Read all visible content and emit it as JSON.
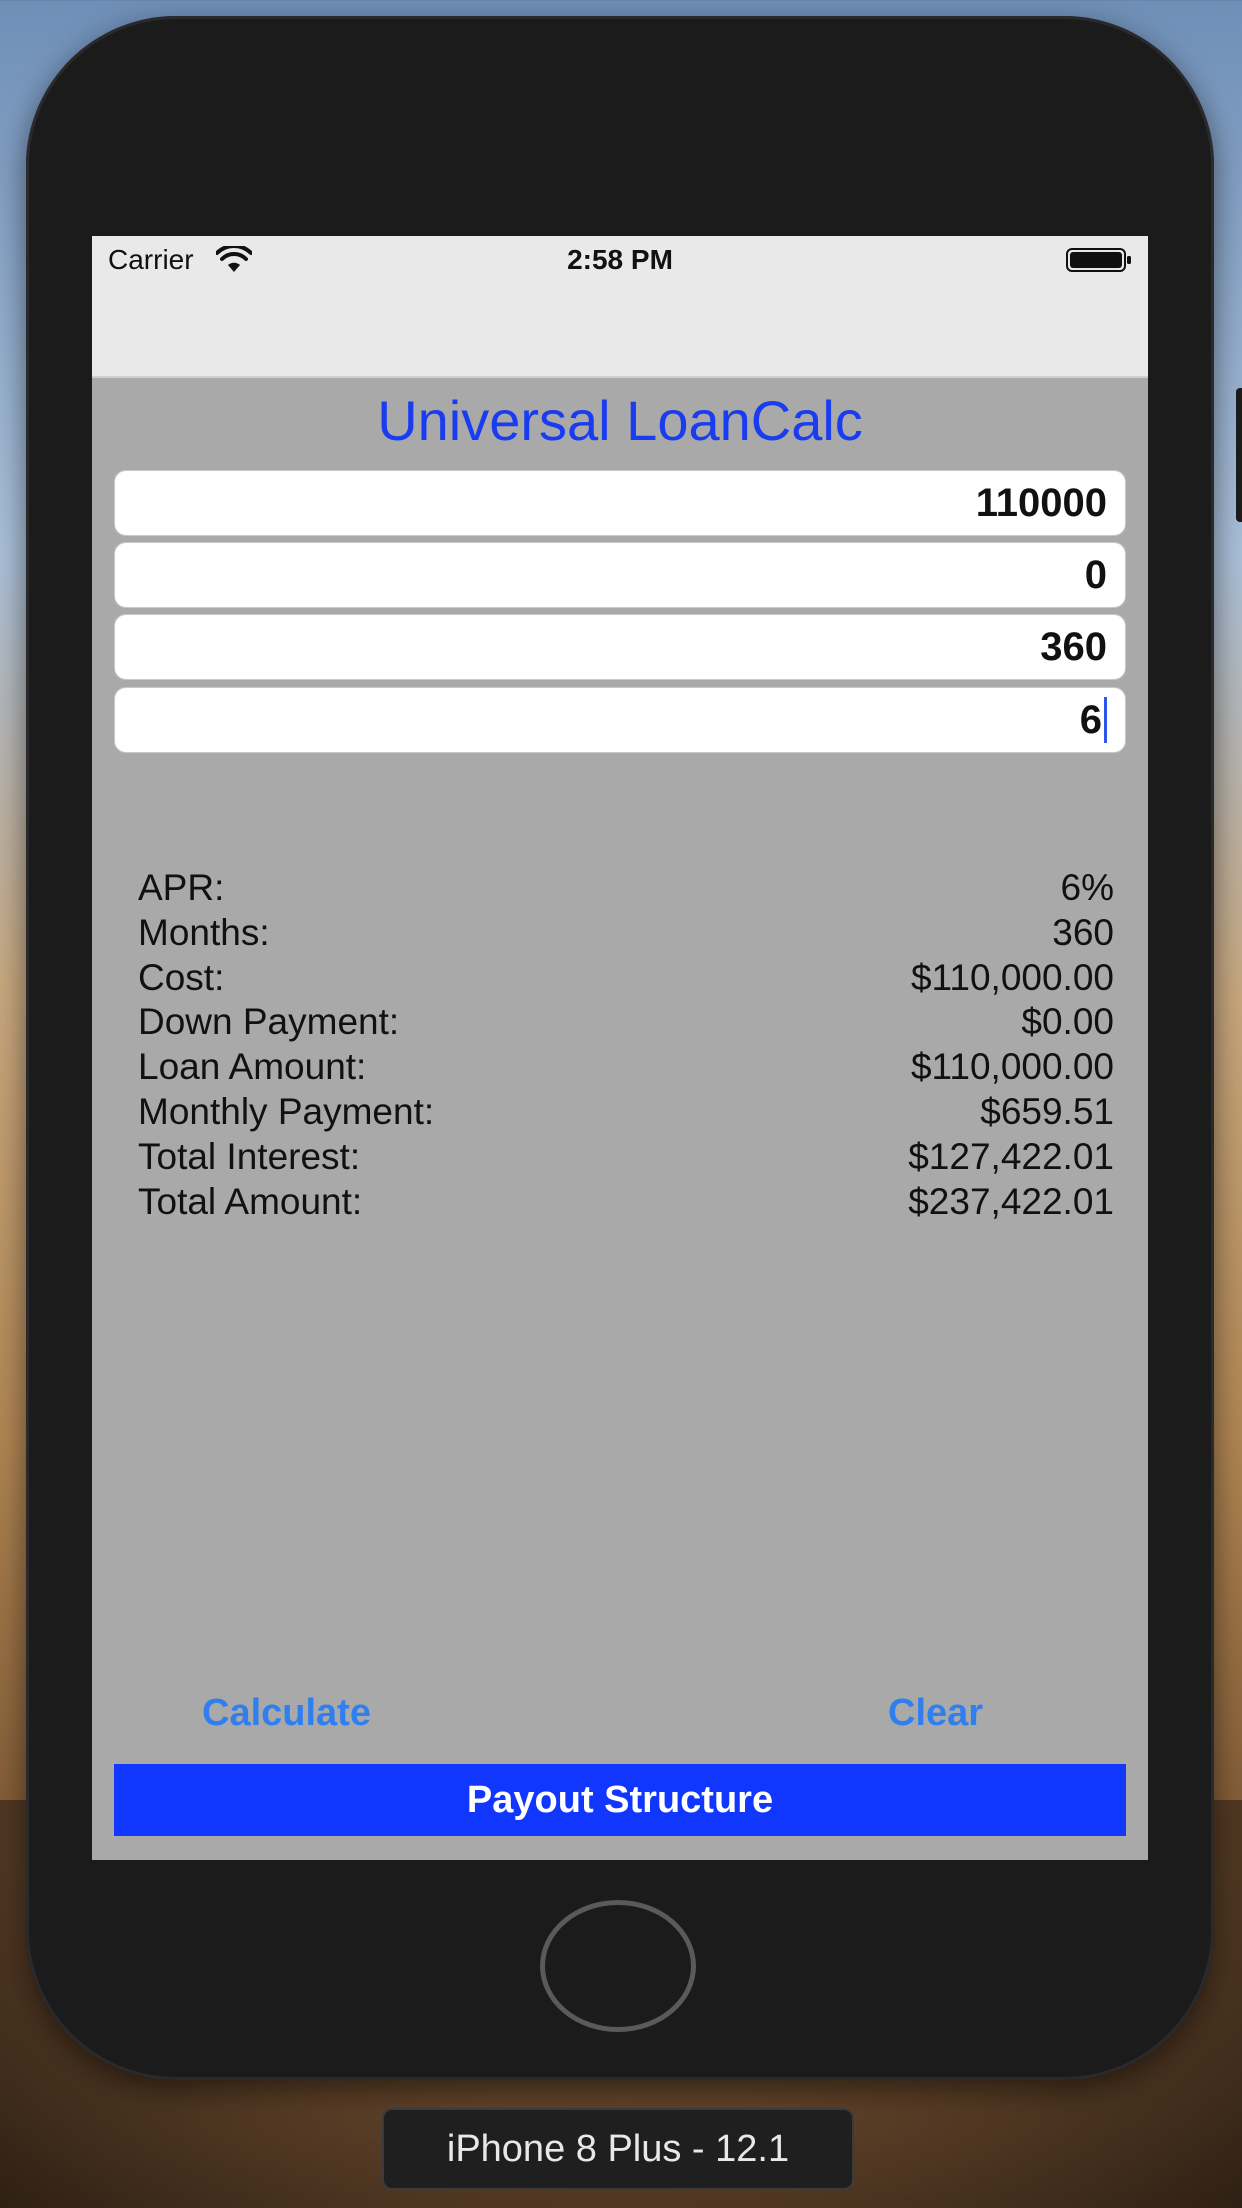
{
  "status": {
    "carrier": "Carrier",
    "time": "2:58 PM"
  },
  "app": {
    "title": "Universal LoanCalc"
  },
  "fields": {
    "cost": "110000",
    "down_payment": "0",
    "months": "360",
    "apr": "6"
  },
  "results": [
    {
      "label": "APR:",
      "value": "6%"
    },
    {
      "label": "Months:",
      "value": "360"
    },
    {
      "label": "Cost:",
      "value": "$110,000.00"
    },
    {
      "label": "Down Payment:",
      "value": "$0.00"
    },
    {
      "label": "Loan Amount:",
      "value": "$110,000.00"
    },
    {
      "label": "Monthly Payment:",
      "value": "$659.51"
    },
    {
      "label": "Total Interest:",
      "value": "$127,422.01"
    },
    {
      "label": "Total Amount:",
      "value": "$237,422.01"
    }
  ],
  "buttons": {
    "calculate": "Calculate",
    "clear": "Clear",
    "payout": "Payout Structure"
  },
  "device": {
    "label": "iPhone 8 Plus - 12.1"
  },
  "colors": {
    "title_blue": "#1a3cf0",
    "button_blue": "#2f7ff0",
    "payout_blue": "#1137ff",
    "screen_gray": "#a9a9a9"
  },
  "icons": {
    "wifi": "wifi-icon",
    "battery": "battery-icon"
  }
}
